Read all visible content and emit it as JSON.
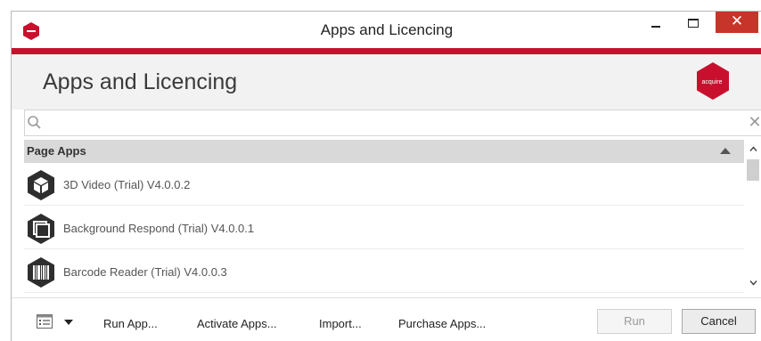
{
  "window": {
    "title": "Apps and Licencing",
    "close_glyph": "✕"
  },
  "header": {
    "title": "Apps and Licencing",
    "logo_text": "acquire",
    "brand_color": "#c8102e"
  },
  "search": {
    "value": "",
    "placeholder": "",
    "clear_glyph": "✕"
  },
  "list": {
    "group_label": "Page Apps",
    "items": [
      {
        "label": "3D Video (Trial) V4.0.0.2",
        "icon": "cube-icon"
      },
      {
        "label": "Background Respond (Trial) V4.0.0.1",
        "icon": "layers-icon"
      },
      {
        "label": "Barcode Reader (Trial) V4.0.0.3",
        "icon": "barcode-icon"
      }
    ]
  },
  "footer": {
    "run_app_label": "Run App...",
    "activate_apps_label": "Activate Apps...",
    "import_label": "Import...",
    "purchase_apps_label": "Purchase Apps...",
    "run_label": "Run",
    "cancel_label": "Cancel"
  }
}
